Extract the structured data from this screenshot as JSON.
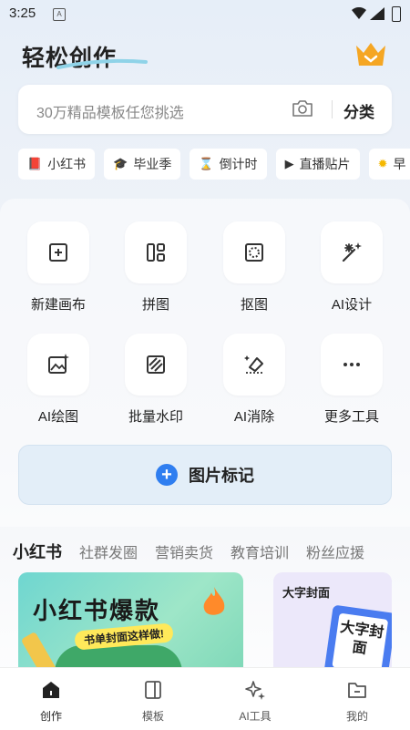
{
  "status_bar": {
    "time": "3:25",
    "notification_glyph": "A"
  },
  "header": {
    "title": "轻松创作",
    "crown_icon": "crown-icon",
    "crown_color": "#f5a623"
  },
  "search": {
    "placeholder": "30万精品模板任您挑选",
    "category_label": "分类"
  },
  "quick_chips": [
    {
      "icon": "notebook-icon",
      "label": "小红书"
    },
    {
      "icon": "graduation-cap-icon",
      "label": "毕业季"
    },
    {
      "icon": "hourglass-icon",
      "label": "倒计时"
    },
    {
      "icon": "play-icon",
      "label": "直播贴片"
    },
    {
      "icon": "sun-icon",
      "label": "早"
    }
  ],
  "tools": [
    {
      "icon": "new-canvas-icon",
      "label": "新建画布"
    },
    {
      "icon": "collage-icon",
      "label": "拼图"
    },
    {
      "icon": "cutout-icon",
      "label": "抠图"
    },
    {
      "icon": "ai-design-icon",
      "label": "AI设计"
    },
    {
      "icon": "ai-paint-icon",
      "label": "AI绘图"
    },
    {
      "icon": "batch-watermark-icon",
      "label": "批量水印"
    },
    {
      "icon": "eraser-icon",
      "label": "AI消除"
    },
    {
      "icon": "more-icon",
      "label": "更多工具"
    }
  ],
  "image_mark": {
    "label": "图片标记",
    "accent": "#2f7ef0"
  },
  "category_tabs": [
    {
      "label": "小红书",
      "active": true
    },
    {
      "label": "社群发圈"
    },
    {
      "label": "营销卖货"
    },
    {
      "label": "教育培训"
    },
    {
      "label": "粉丝应援"
    }
  ],
  "cards": {
    "main": {
      "title": "小红书爆款",
      "subtitle": "书单封面这样做!"
    },
    "side": {
      "title": "大字封面",
      "inner_text": "大字封面"
    }
  },
  "bottom_nav": [
    {
      "icon": "home-icon",
      "label": "创作",
      "active": true
    },
    {
      "icon": "template-icon",
      "label": "模板"
    },
    {
      "icon": "ai-tools-icon",
      "label": "AI工具"
    },
    {
      "icon": "folder-icon",
      "label": "我的"
    }
  ]
}
